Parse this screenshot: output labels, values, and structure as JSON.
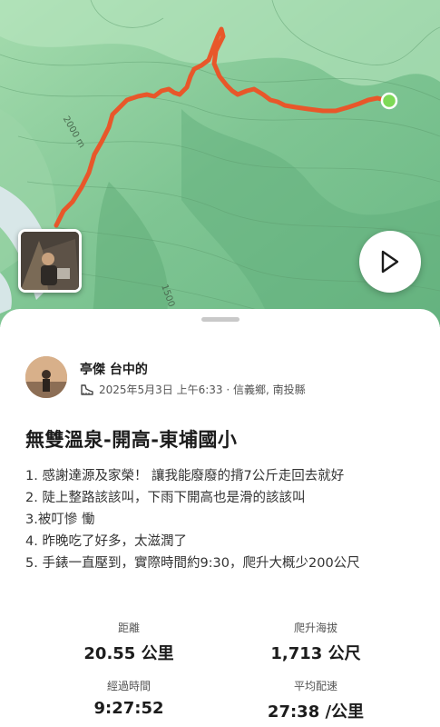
{
  "map": {
    "contour_labels": [
      "2000 m",
      "1500"
    ],
    "route_color": "#e8572a",
    "end_marker_color": "#7ed957"
  },
  "activity": {
    "user_name": "亭傑 台中的",
    "meta": "2025年5月3日 上午6:33 · 信義鄉, 南投縣",
    "title": "無雙溫泉-開高-東埔國小",
    "description": [
      "1. 感謝達源及家榮！ 讓我能廢廢的揹7公斤走回去就好",
      "2. 陡上整路該該叫，下雨下開高也是滑的該該叫",
      "3.被叮慘 慟",
      "4. 昨晚吃了好多，太滋潤了",
      "5. 手錶一直壓到，實際時間約9:30，爬升大概少200公尺"
    ]
  },
  "stats": {
    "distance_label": "距離",
    "distance_value": "20.55 公里",
    "elevation_label": "爬升海拔",
    "elevation_value": "1,713 公尺",
    "time_label": "經過時間",
    "time_value": "9:27:52",
    "pace_label": "平均配速",
    "pace_value": "27:38 /公里"
  }
}
